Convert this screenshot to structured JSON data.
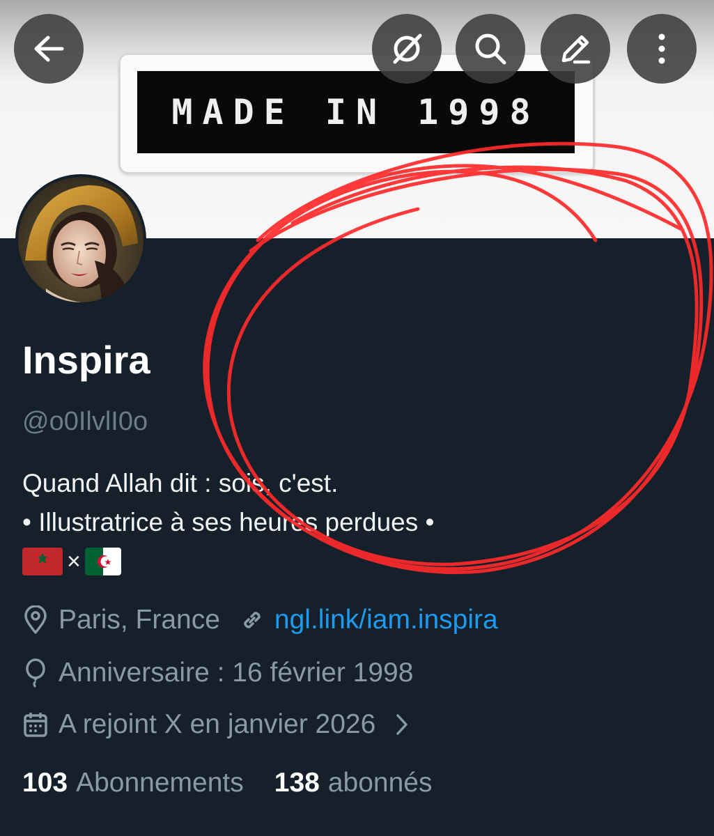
{
  "header": {
    "banner_text": "MADE IN 1998",
    "buttons": {
      "back": "arrow-left-icon",
      "grok": "grok-icon",
      "search": "search-icon",
      "edit": "pencil-icon",
      "more": "more-vertical-icon"
    }
  },
  "profile": {
    "name": "Inspira",
    "handle": "@o0IlvlI0o",
    "bio": {
      "line1": "Quand Allah dit : sois, c'est.",
      "line2": "• Illustratrice à ses heures perdues •",
      "flags_separator": "×",
      "flags": [
        "morocco-flag",
        "algeria-flag"
      ]
    },
    "location": "Paris, France",
    "website": "ngl.link/iam.inspira",
    "birthday": "Anniversaire : 16 février 1998",
    "joined": "A rejoint X en janvier 2026"
  },
  "stats": {
    "following_count": "103",
    "following_label": "Abonnements",
    "followers_count": "138",
    "followers_label": "abonnés"
  },
  "colors": {
    "background": "#15202b",
    "text_primary": "#ffffff",
    "text_secondary": "#8b98a5",
    "link": "#1d9bf0",
    "annotation": "#ff2a2a"
  }
}
